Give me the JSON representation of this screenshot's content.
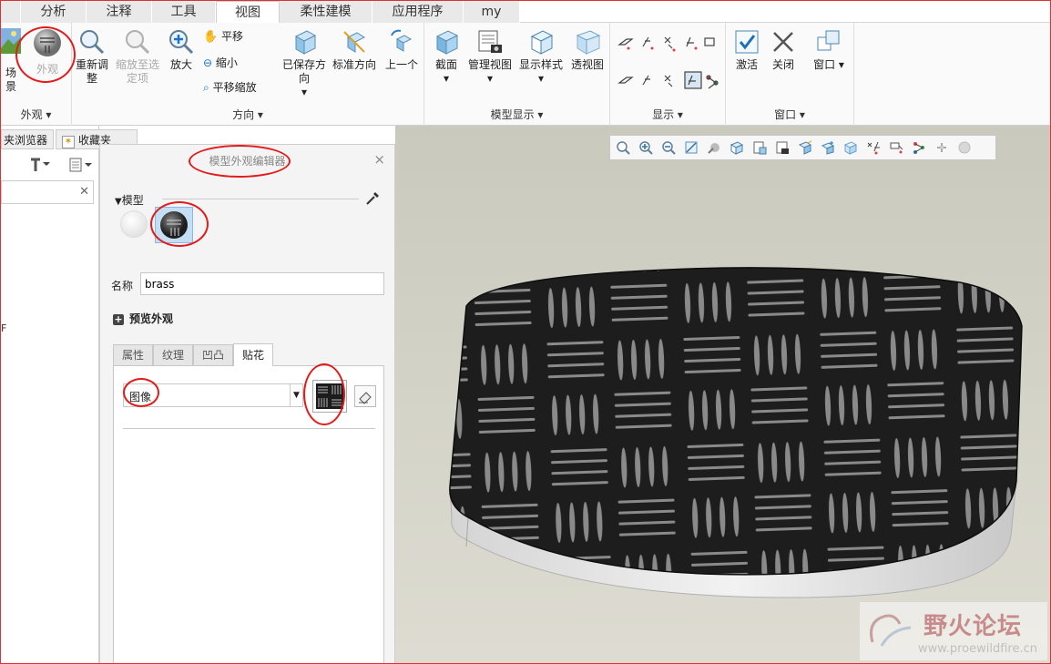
{
  "tabs": [
    {
      "label": "分析",
      "active": false
    },
    {
      "label": "注释",
      "active": false
    },
    {
      "label": "工具",
      "active": false
    },
    {
      "label": "视图",
      "active": true
    },
    {
      "label": "柔性建模",
      "active": false
    },
    {
      "label": "应用程序",
      "active": false
    },
    {
      "label": "my",
      "active": false
    }
  ],
  "ribbon": {
    "appearance_group": {
      "label": "外观",
      "scene_label": "场景",
      "appearance_label": "外观"
    },
    "orientation_group": {
      "label": "方向",
      "refit_label": "重新调整",
      "zoom_selected_label": "缩放至选定项",
      "zoom_in_label": "放大",
      "pan_label": "平移",
      "zoom_out_label": "缩小",
      "pan_zoom_label": "平移缩放",
      "saved_orient_label": "已保存方向",
      "std_orient_label": "标准方向",
      "previous_label": "上一个"
    },
    "model_display_group": {
      "label": "模型显示",
      "section_label": "截面",
      "manage_views_label": "管理视图",
      "display_style_label": "显示样式",
      "perspective_label": "透视图"
    },
    "show_group": {
      "label": "显示"
    },
    "window_group": {
      "label": "窗口",
      "activate_label": "激活",
      "close_label": "关闭",
      "windows_label": "窗口"
    }
  },
  "left_panel": {
    "tab1": "夹浏览器",
    "tab2": "收藏夹",
    "tree_char": "F"
  },
  "editor": {
    "title": "模型外观编辑器",
    "close_glyph": "×",
    "section_label": "模型",
    "name_label": "名称",
    "name_value": "brass",
    "preview_label": "预览外观",
    "subtabs": [
      {
        "label": "属性",
        "active": false
      },
      {
        "label": "纹理",
        "active": false
      },
      {
        "label": "凹凸",
        "active": false
      },
      {
        "label": "贴花",
        "active": true
      }
    ],
    "decal_type": "图像"
  },
  "watermark": {
    "title": "野火论坛",
    "url": "www.proewildfire.cn"
  },
  "colors": {
    "annotation_red": "#e21b1b",
    "model_dark": "#1c1c1c",
    "model_stripe": "#8a8a8a",
    "viewport_bg": "#d2d1c6"
  }
}
